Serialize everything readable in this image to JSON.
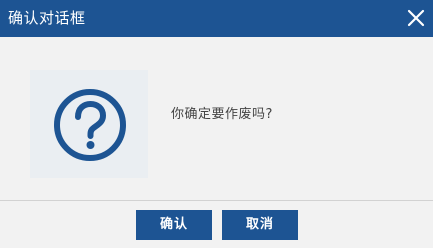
{
  "dialog": {
    "title": "确认对话框",
    "close_icon": "close-icon",
    "message": "你确定要作废吗?",
    "question_icon": "question-circle-icon",
    "buttons": {
      "confirm_label": "确认",
      "cancel_label": "取消"
    }
  },
  "colors": {
    "titlebar_bg": "#1d5493",
    "button_bg": "#1d5493",
    "icon_color": "#1d5493",
    "body_bg": "#f2f2f2"
  }
}
